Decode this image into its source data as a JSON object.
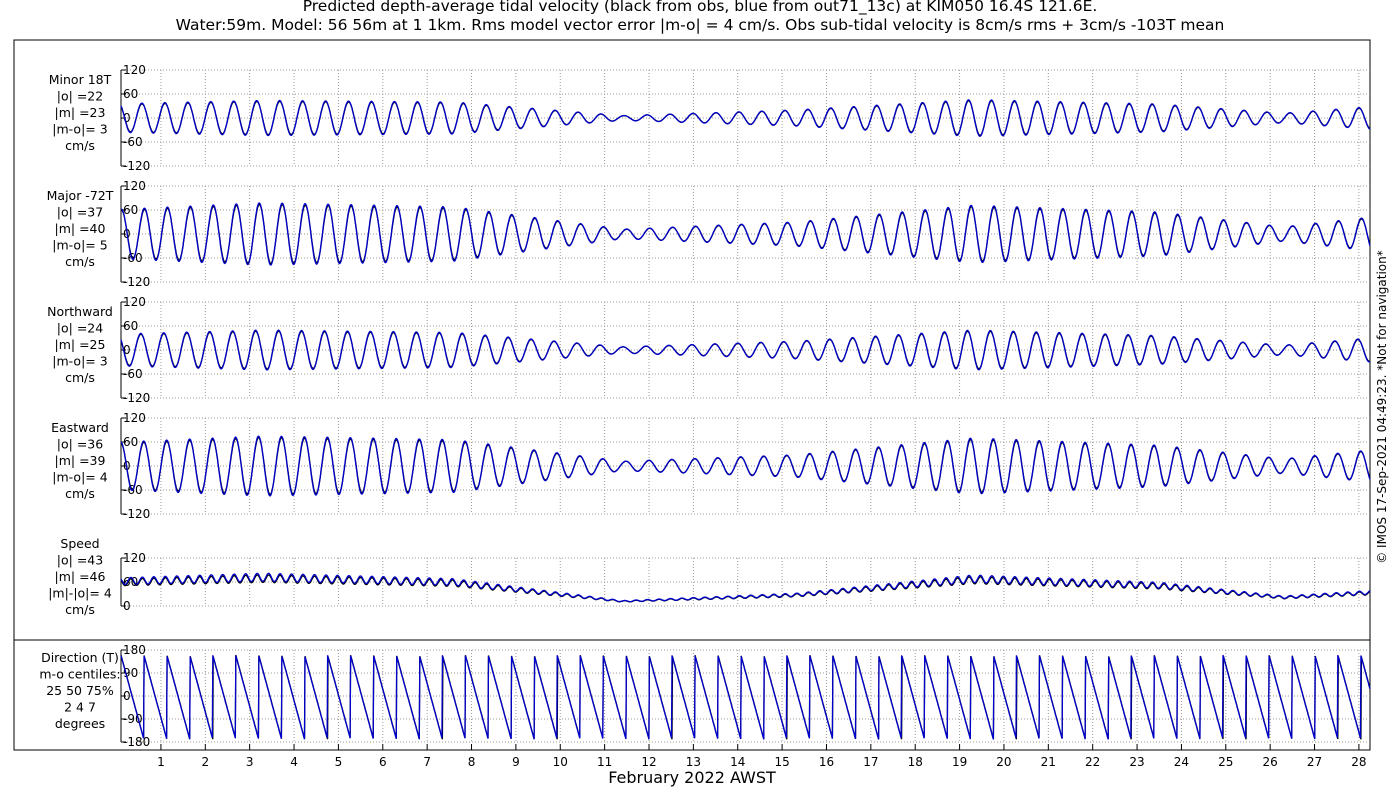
{
  "title_lines": [
    "Predicted depth-average tidal velocity (black from obs, blue from out71_13c) at KIM050 16.4S 121.6E.",
    "Water:59m. Model: 56 56m at 1 1km. Rms model vector error |m-o| = 4 cm/s. Obs sub-tidal velocity is 8cm/s rms + 3cm/s -103T mean"
  ],
  "copyright": "© IMOS 17-Sep-2021 04:49:23. *Not for navigation*",
  "xlabel": "February 2022 AWST",
  "colors": {
    "obs": "#000000",
    "model": "#0000cc",
    "grid": "#9a9a9a"
  },
  "panels": [
    {
      "id": "minor",
      "label_lines": [
        "Minor 18T",
        "|o| =22",
        "|m| =23",
        "|m-o|= 3",
        "cm/s"
      ],
      "yticks": [
        "120",
        "60",
        "0",
        "-60",
        "-120"
      ],
      "ylim": [
        -120,
        120
      ]
    },
    {
      "id": "major",
      "label_lines": [
        "Major -72T",
        "|o| =37",
        "|m| =40",
        "|m-o|= 5",
        "cm/s"
      ],
      "yticks": [
        "120",
        "60",
        "0",
        "-60",
        "-120"
      ],
      "ylim": [
        -120,
        120
      ]
    },
    {
      "id": "northward",
      "label_lines": [
        "Northward",
        "|o| =24",
        "|m| =25",
        "|m-o|= 3",
        "cm/s"
      ],
      "yticks": [
        "120",
        "60",
        "0",
        "-60",
        "-120"
      ],
      "ylim": [
        -120,
        120
      ]
    },
    {
      "id": "eastward",
      "label_lines": [
        "Eastward",
        "|o| =36",
        "|m| =39",
        "|m-o|= 4",
        "cm/s"
      ],
      "yticks": [
        "120",
        "60",
        "0",
        "-60",
        "-120"
      ],
      "ylim": [
        -120,
        120
      ]
    },
    {
      "id": "speed",
      "label_lines": [
        "Speed",
        "|o| =43",
        "|m| =46",
        "|m|-|o|= 4",
        "cm/s"
      ],
      "yticks": [
        "120",
        "60",
        "0"
      ],
      "ylim": [
        0,
        120
      ]
    },
    {
      "id": "direction",
      "label_lines": [
        "Direction (T)",
        "m-o centiles:",
        "25  50  75%",
        "2   4   7",
        "degrees"
      ],
      "yticks": [
        "180",
        "90",
        "0",
        "-90",
        "-180"
      ],
      "ylim": [
        -180,
        180
      ]
    }
  ],
  "chart_data": {
    "type": "line",
    "title": "Predicted depth-average tidal velocity (black from obs, blue from out71_13c) at KIM050 16.4S 121.6E.",
    "xlabel": "February 2022 AWST",
    "x_tick_labels": [
      "1",
      "2",
      "3",
      "4",
      "5",
      "6",
      "7",
      "8",
      "9",
      "10",
      "11",
      "12",
      "13",
      "14",
      "15",
      "16",
      "17",
      "18",
      "19",
      "20",
      "21",
      "22",
      "23",
      "24",
      "25",
      "26",
      "27",
      "28"
    ],
    "xlim": [
      0.1,
      28.25
    ],
    "grid": true,
    "series": [
      {
        "name": "obs",
        "color": "#000000"
      },
      {
        "name": "out71_13c",
        "color": "#0000cc"
      }
    ],
    "envelope_amplitude": {
      "day": [
        0.1,
        3.3,
        7.6,
        11.4,
        15.3,
        19.3,
        23.5,
        26.3,
        28.25
      ],
      "minor": [
        36,
        44,
        40,
        6,
        20,
        46,
        35,
        12,
        28
      ],
      "major": [
        62,
        78,
        68,
        12,
        30,
        72,
        55,
        18,
        42
      ],
      "northward": [
        40,
        50,
        44,
        8,
        22,
        50,
        36,
        12,
        30
      ],
      "eastward": [
        60,
        75,
        66,
        12,
        28,
        70,
        52,
        18,
        40
      ],
      "speed_mean": [
        62,
        72,
        60,
        12,
        28,
        68,
        52,
        22,
        34
      ]
    },
    "period_days": 0.5175,
    "direction_range": [
      -180,
      180
    ]
  }
}
